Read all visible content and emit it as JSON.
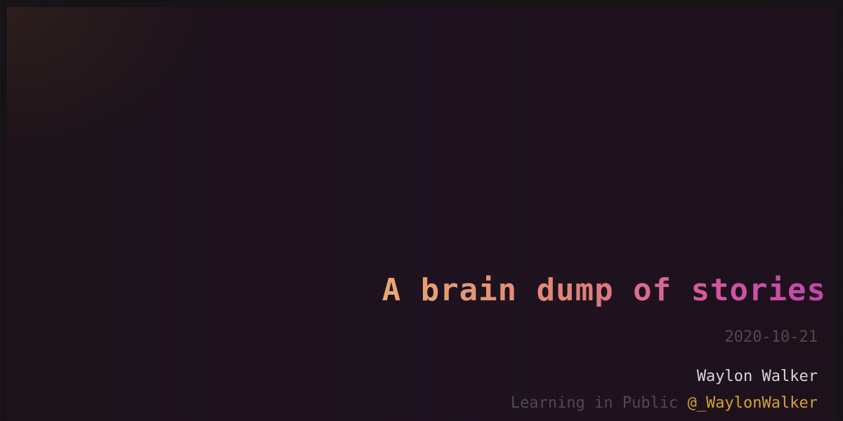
{
  "post": {
    "title": "A brain dump of stories",
    "date": "2020-10-21",
    "author": "Waylon Walker",
    "tagline": "Learning in Public",
    "handle": "@_WaylonWalker"
  },
  "colors": {
    "title_gradient_start": "#e8a86c",
    "title_gradient_end": "#c443b0",
    "muted": "#54484f",
    "author": "#d8d2d6",
    "handle": "#d3a231",
    "background": "#1e1220"
  }
}
